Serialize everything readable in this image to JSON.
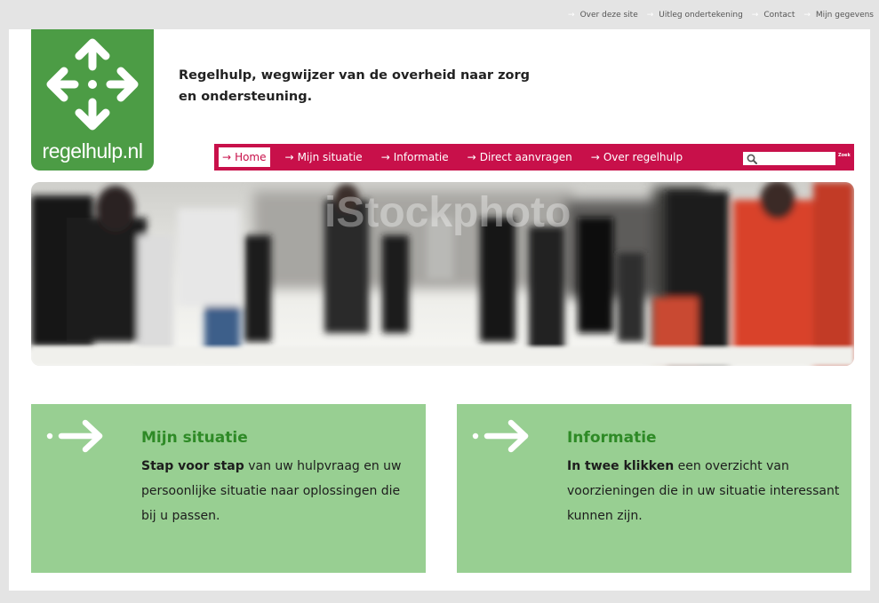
{
  "top_links": [
    {
      "label": "Over deze site"
    },
    {
      "label": "Uitleg ondertekening"
    },
    {
      "label": "Contact"
    },
    {
      "label": "Mijn gegevens"
    }
  ],
  "logo": {
    "text": "regelhulp.nl",
    "color": "#4c9c45"
  },
  "tagline": {
    "line1": "Regelhulp, wegwijzer van de overheid naar zorg",
    "line2": "en ondersteuning."
  },
  "nav": {
    "arrow": "→",
    "items": [
      {
        "label": "Home",
        "active": true
      },
      {
        "label": "Mijn situatie"
      },
      {
        "label": "Informatie"
      },
      {
        "label": "Direct aanvragen"
      },
      {
        "label": "Over regelhulp"
      }
    ],
    "color": "#c8104a"
  },
  "search": {
    "placeholder": "",
    "button_label": "Zoek",
    "icon": "search-icon"
  },
  "hero": {
    "watermark": "iStockphoto"
  },
  "cards": [
    {
      "title": "Mijn situatie",
      "strong": "Stap voor stap",
      "text": " van uw hulpvraag en uw persoonlijke situatie naar oplossingen die bij u passen.",
      "icon": "arrow-right-icon"
    },
    {
      "title": "Informatie",
      "strong": "In twee klikken",
      "text": " een overzicht van voorzieningen die in uw situatie interessant kunnen zijn.",
      "icon": "arrow-right-icon"
    }
  ],
  "colors": {
    "card_bg": "#98cf92",
    "card_title": "#2e8a26",
    "page_bg": "#e4e4e4"
  }
}
